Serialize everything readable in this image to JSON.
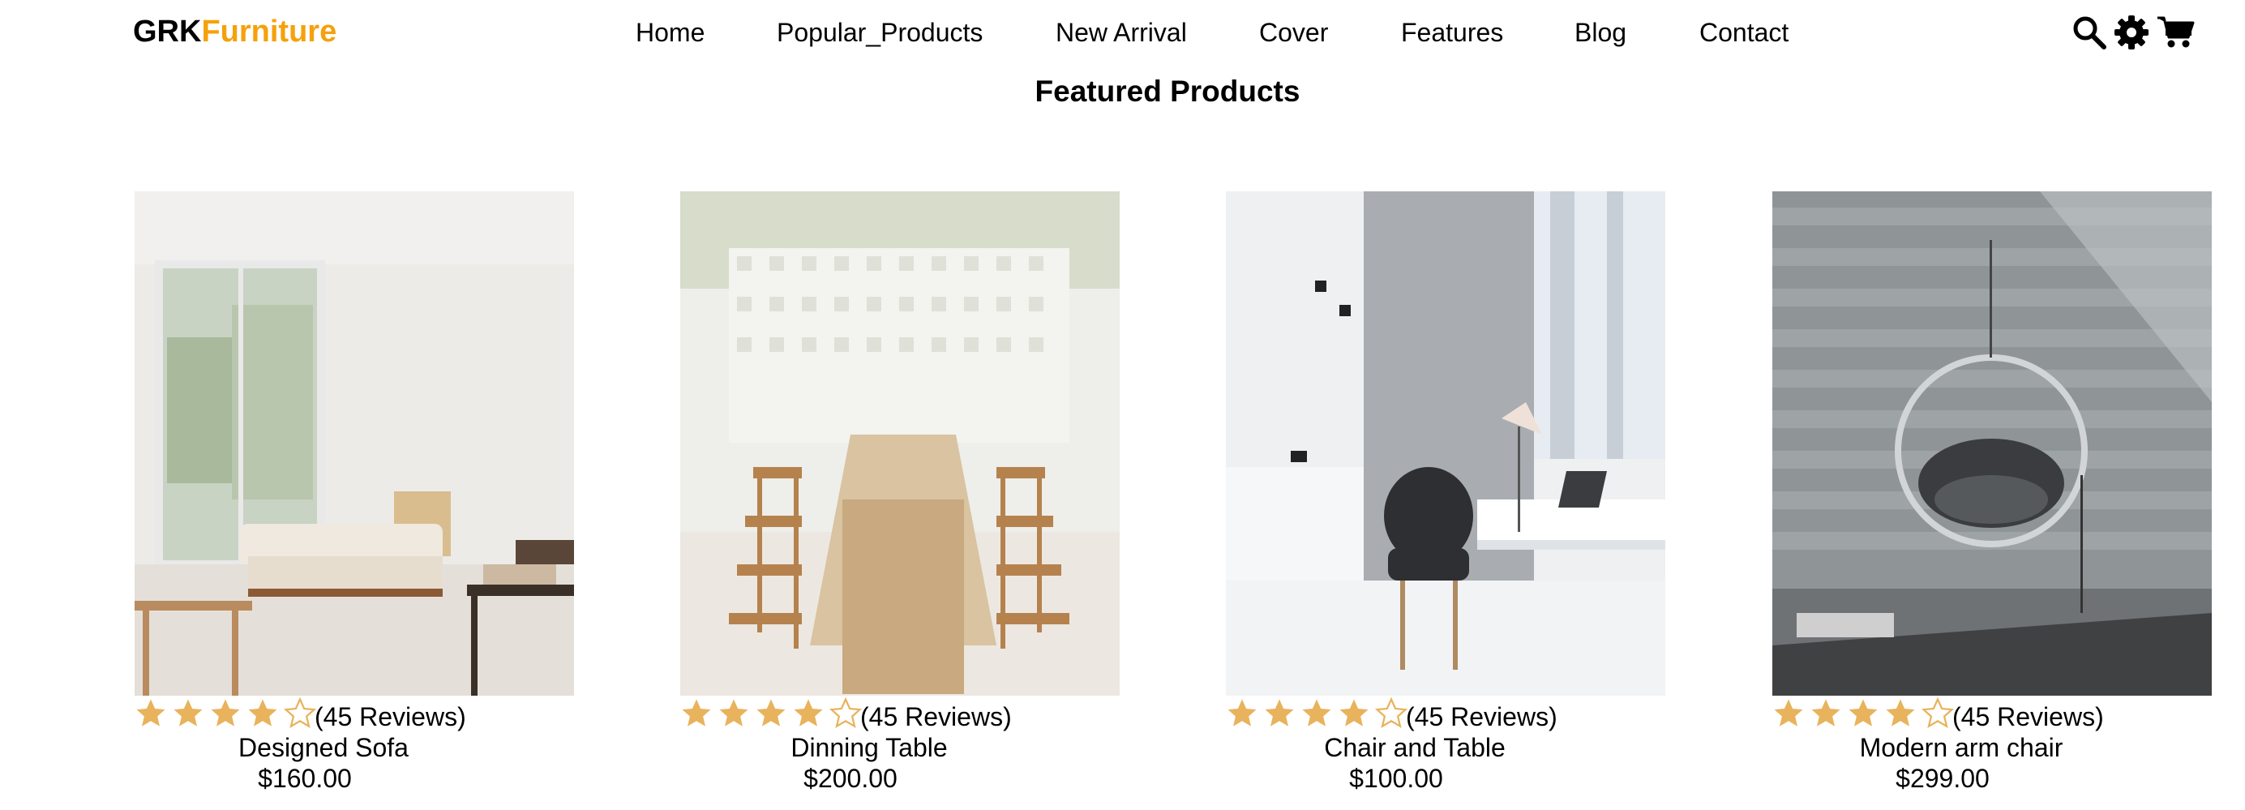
{
  "header": {
    "logo_part1": "GRK",
    "logo_part2": "Furniture",
    "nav": [
      "Home",
      "Popular_Products",
      "New Arrival",
      "Cover",
      "Features",
      "Blog",
      "Contact"
    ],
    "icons": [
      "search-icon",
      "gear-icon",
      "cart-icon"
    ]
  },
  "section_title": "Featured Products",
  "products": [
    {
      "name": "Designed Sofa",
      "price": "$160.00",
      "reviews": "(45 Reviews)",
      "rating": 4,
      "rating_max": 5
    },
    {
      "name": "Dinning Table",
      "price": "$200.00",
      "reviews": "(45 Reviews)",
      "rating": 4,
      "rating_max": 5
    },
    {
      "name": "Chair and Table",
      "price": "$100.00",
      "reviews": "(45 Reviews)",
      "rating": 4,
      "rating_max": 5
    },
    {
      "name": "Modern arm chair",
      "price": "$299.00",
      "reviews": "(45 Reviews)",
      "rating": 4,
      "rating_max": 5
    }
  ],
  "colors": {
    "accent": "#f5a10c",
    "star": "#e8b35c"
  }
}
